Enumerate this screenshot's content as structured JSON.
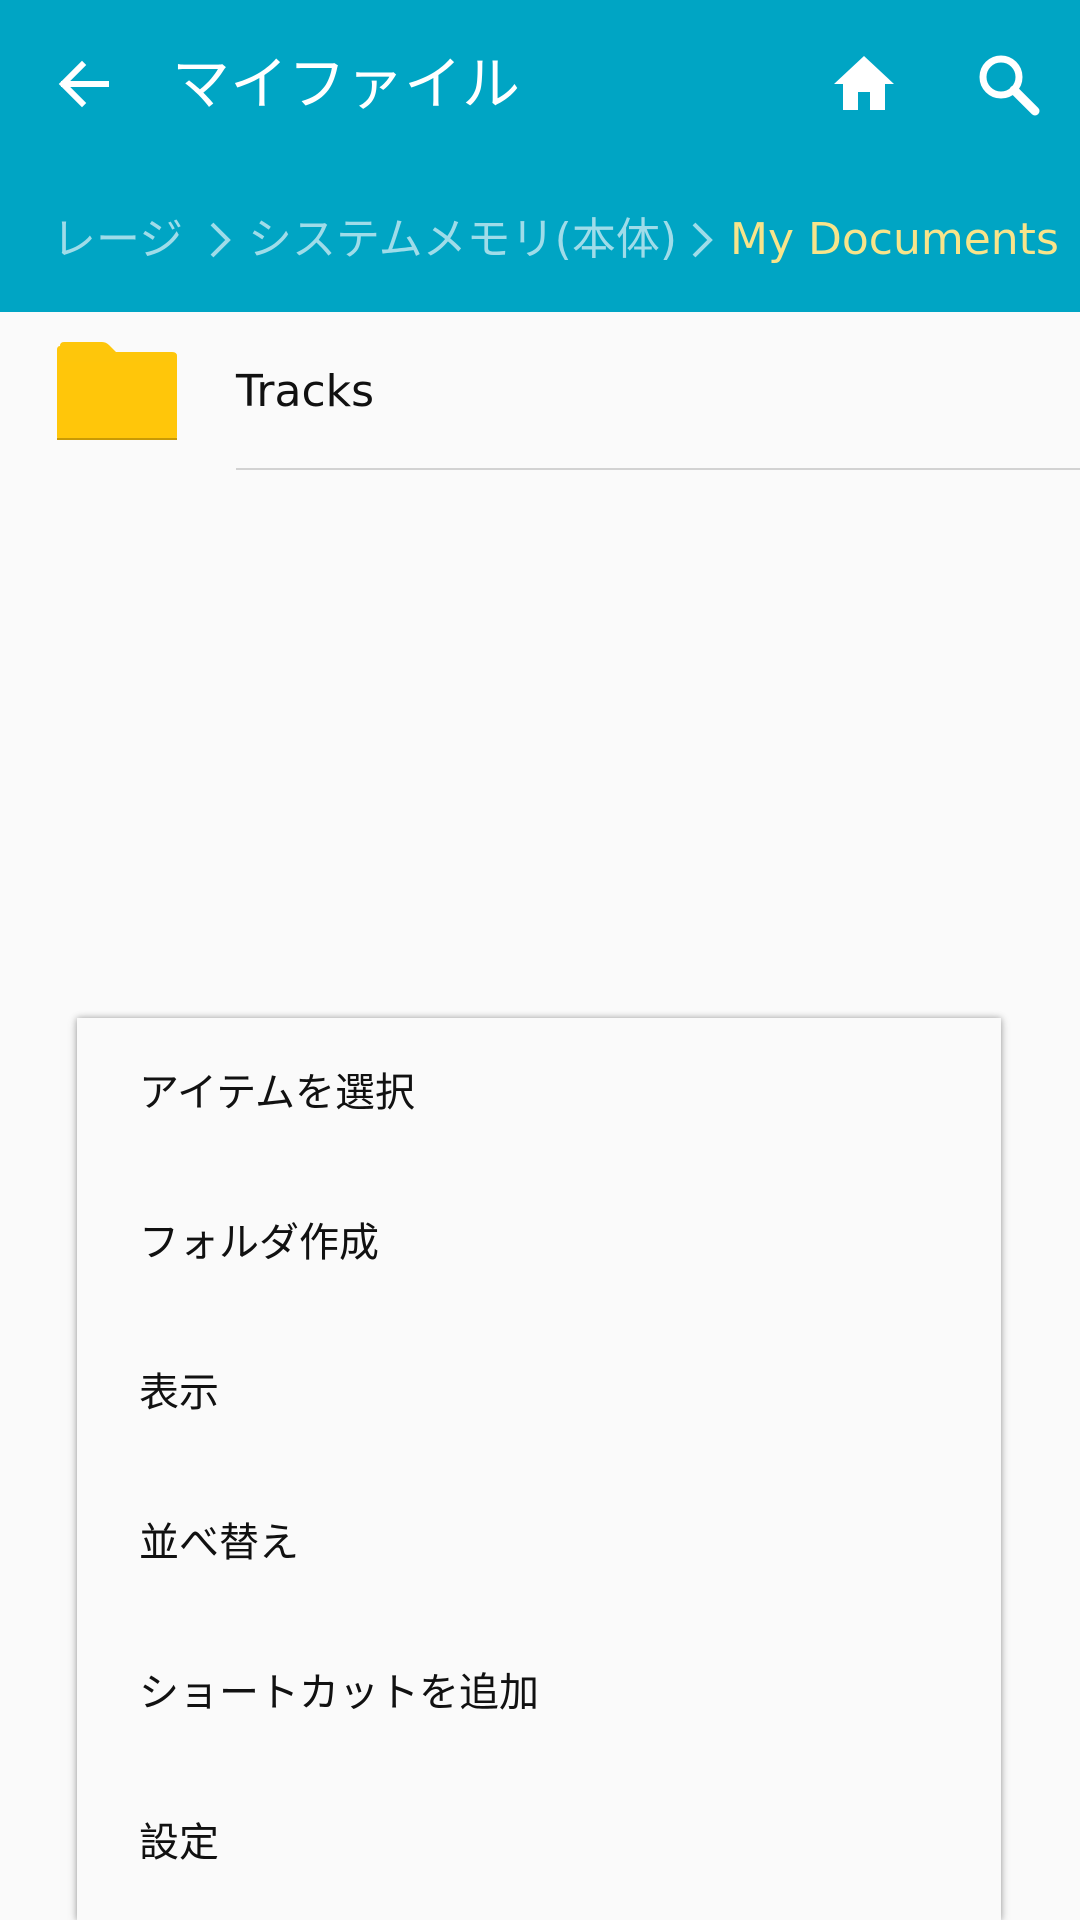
{
  "appbar": {
    "title": "マイファイル",
    "background_color": "#00a5c4",
    "icons": {
      "back": "arrow-left-icon",
      "home": "home-icon",
      "search": "search-icon"
    }
  },
  "breadcrumb": {
    "items": [
      {
        "label": "レージ"
      },
      {
        "label": "システムメモリ(本体)"
      },
      {
        "label": "My Documents"
      }
    ],
    "separator_icon": "chevron-right-icon",
    "current_color": "#f8e48a"
  },
  "list": {
    "items": [
      {
        "label": "Tracks",
        "icon": "folder-icon",
        "icon_color": "#fec60b"
      }
    ]
  },
  "menu": {
    "items": [
      {
        "label": "アイテムを選択"
      },
      {
        "label": "フォルダ作成"
      },
      {
        "label": "表示"
      },
      {
        "label": "並べ替え"
      },
      {
        "label": "ショートカットを追加"
      },
      {
        "label": "設定"
      }
    ]
  }
}
